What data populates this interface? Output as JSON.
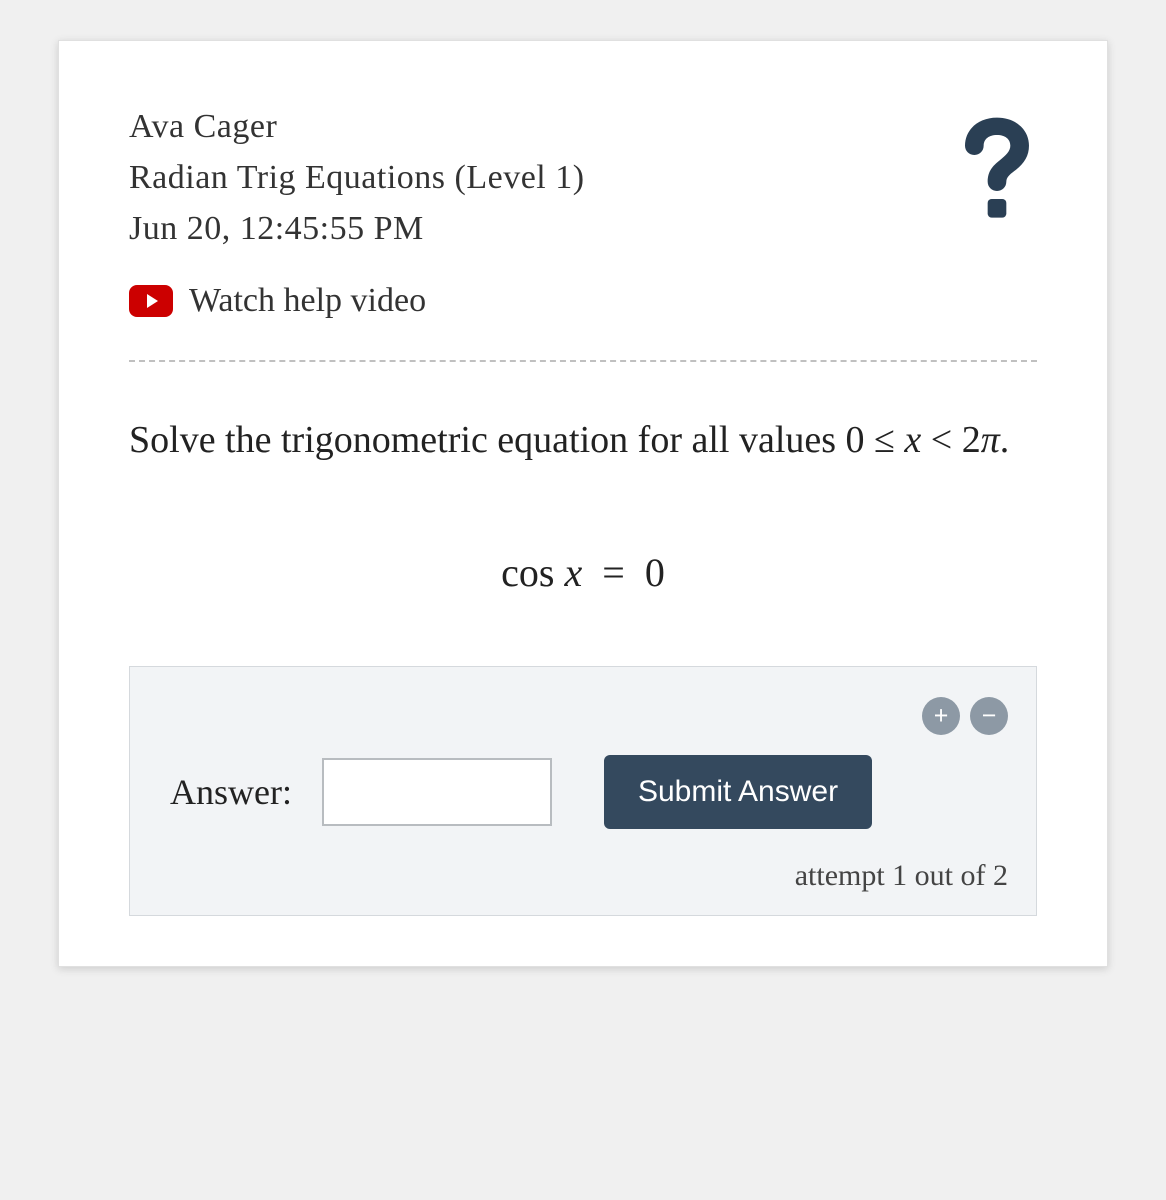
{
  "header": {
    "student_name": "Ava Cager",
    "assignment_title": "Radian Trig Equations (Level 1)",
    "datetime": "Jun 20, 12:45:55 PM"
  },
  "video_link": {
    "label": "Watch help video"
  },
  "problem": {
    "prompt_prefix": "Solve the trigonometric equation for all values ",
    "domain_math": "0 ≤ x < 2π.",
    "equation": "cos x = 0"
  },
  "answer_area": {
    "label": "Answer:",
    "input_value": "",
    "submit_label": "Submit Answer",
    "plus_label": "+",
    "minus_label": "−",
    "attempt_text": "attempt 1 out of 2"
  }
}
